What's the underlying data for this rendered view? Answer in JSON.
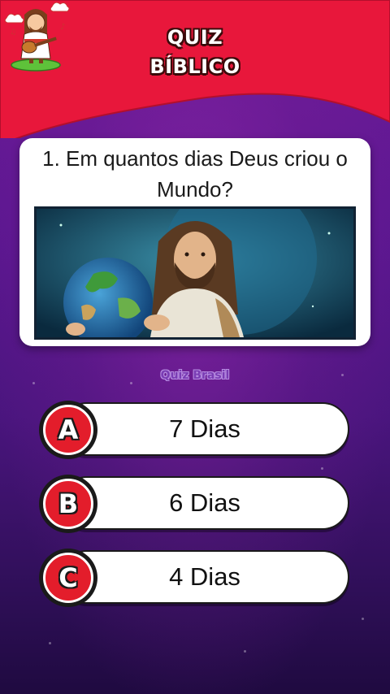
{
  "header": {
    "title_line1": "QUIZ",
    "title_line2": "BÍBLICO",
    "colors": {
      "red": "#e8173b",
      "purple": "#5c1790"
    }
  },
  "question": {
    "text": "1. Em quantos dias Deus criou o Mundo?",
    "image": "jesus-holding-earth-illustration"
  },
  "watermark": "Quiz Brasil",
  "options": [
    {
      "letter": "A",
      "label": "7 Dias"
    },
    {
      "letter": "B",
      "label": "6 Dias"
    },
    {
      "letter": "C",
      "label": "4 Dias"
    }
  ],
  "icons": {
    "mascot": "jesus-guitar-mascot-icon",
    "badge_color": "#e31d2b"
  }
}
